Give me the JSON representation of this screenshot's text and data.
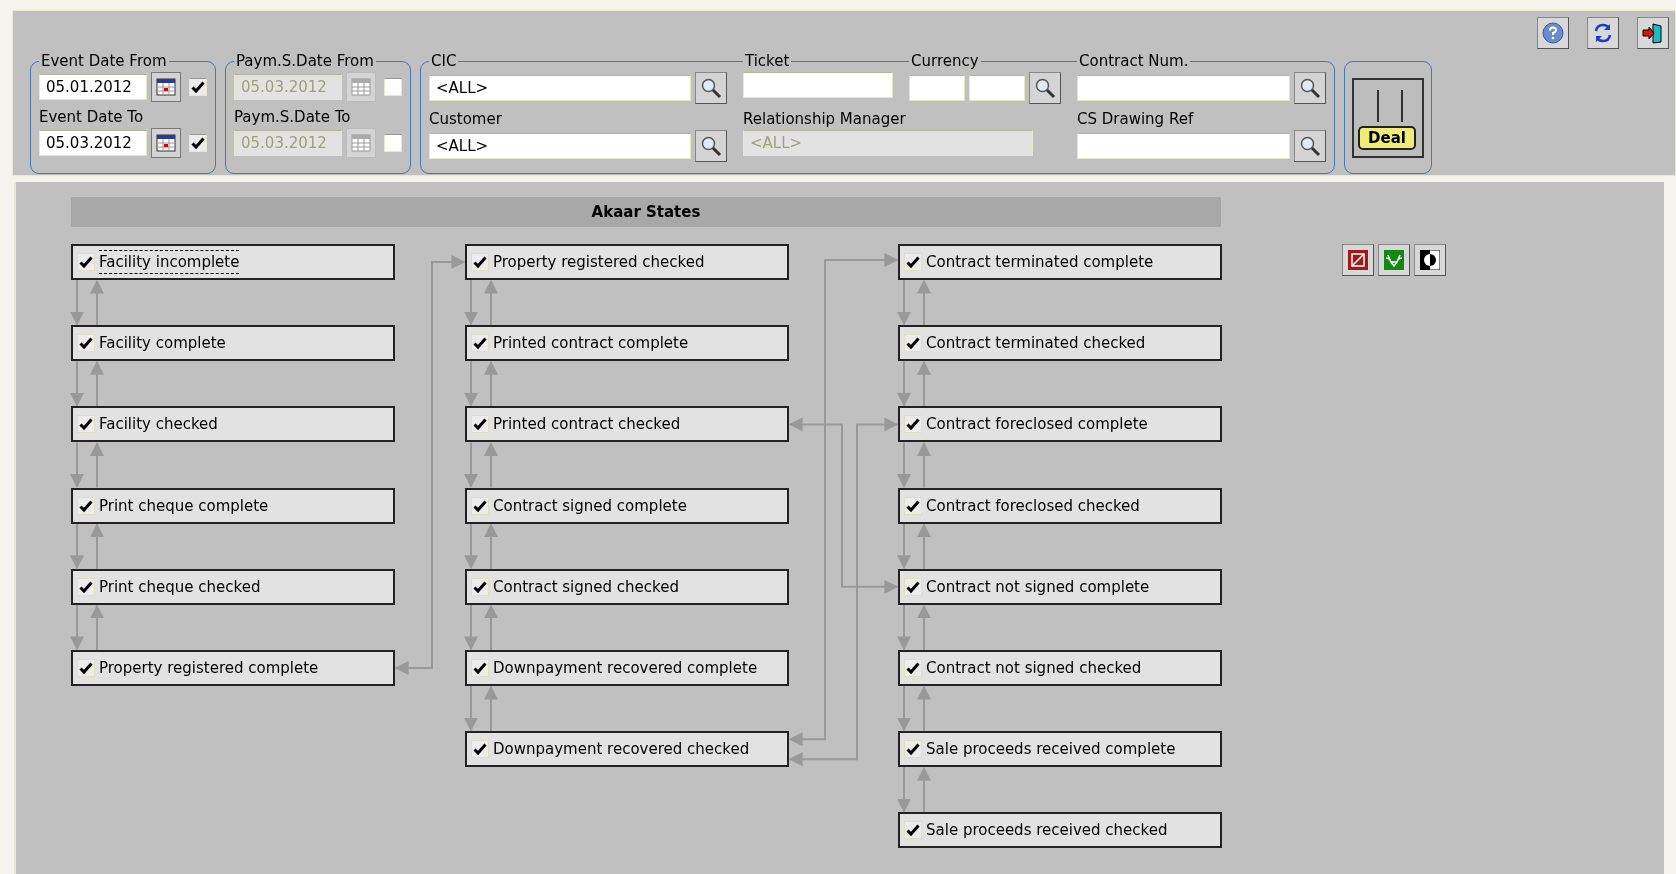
{
  "date_groups": [
    {
      "fields": [
        {
          "label": "Event Date From",
          "value": "05.01.2012",
          "disabled": false,
          "checked": true
        },
        {
          "label": "Event Date To",
          "value": "05.03.2012",
          "disabled": false,
          "checked": true
        }
      ]
    },
    {
      "fields": [
        {
          "label": "Paym.S.Date From",
          "value": "05.03.2012",
          "disabled": true,
          "checked": false
        },
        {
          "label": "Paym.S.Date To",
          "value": "05.03.2012",
          "disabled": true,
          "checked": false
        }
      ]
    }
  ],
  "search": {
    "cic": {
      "label": "CIC",
      "value": "<ALL>"
    },
    "ticket": {
      "label": "Ticket"
    },
    "currency": {
      "label": "Currency"
    },
    "contract_num": {
      "label": "Contract Num."
    },
    "customer": {
      "label": "Customer",
      "value": "<ALL>"
    },
    "relationship_manager": {
      "label": "Relationship Manager",
      "value": "<ALL>",
      "disabled": true
    },
    "cs_drawing_ref": {
      "label": "CS Drawing Ref"
    }
  },
  "deal_button": {
    "label": "Deal"
  },
  "diagram": {
    "title": "Akaar States",
    "columns": [
      [
        {
          "label": "Facility incomplete",
          "checked": true,
          "focused": true
        },
        {
          "label": "Facility complete",
          "checked": true,
          "focused": false
        },
        {
          "label": "Facility checked",
          "checked": true,
          "focused": false
        },
        {
          "label": "Print cheque complete",
          "checked": true,
          "focused": false
        },
        {
          "label": "Print cheque checked",
          "checked": true,
          "focused": false
        },
        {
          "label": "Property registered complete",
          "checked": true,
          "focused": false
        }
      ],
      [
        {
          "label": "Property registered checked",
          "checked": true,
          "focused": false
        },
        {
          "label": "Printed contract complete",
          "checked": true,
          "focused": false
        },
        {
          "label": "Printed contract checked",
          "checked": true,
          "focused": false
        },
        {
          "label": "Contract signed complete",
          "checked": true,
          "focused": false
        },
        {
          "label": "Contract signed checked",
          "checked": true,
          "focused": false
        },
        {
          "label": "Downpayment recovered complete",
          "checked": true,
          "focused": false
        },
        {
          "label": "Downpayment recovered checked",
          "checked": true,
          "focused": false
        }
      ],
      [
        {
          "label": "Contract terminated complete",
          "checked": true,
          "focused": false
        },
        {
          "label": "Contract terminated checked",
          "checked": true,
          "focused": false
        },
        {
          "label": "Contract foreclosed complete",
          "checked": true,
          "focused": false
        },
        {
          "label": "Contract foreclosed checked",
          "checked": true,
          "focused": false
        },
        {
          "label": "Contract not signed complete",
          "checked": true,
          "focused": false
        },
        {
          "label": "Contract not signed checked",
          "checked": true,
          "focused": false
        },
        {
          "label": "Sale proceeds received complete",
          "checked": true,
          "focused": false
        },
        {
          "label": "Sale proceeds received checked",
          "checked": true,
          "focused": false
        }
      ]
    ]
  }
}
